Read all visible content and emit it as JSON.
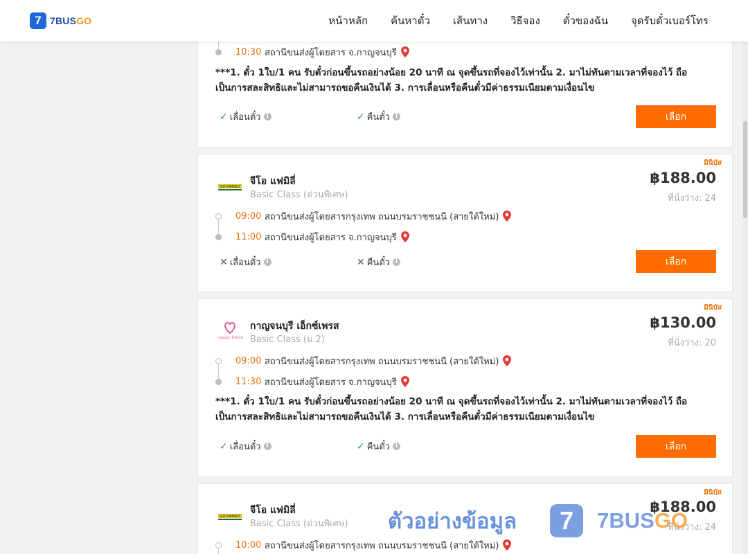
{
  "header": {
    "logo_mark": "7",
    "logo_text_main": "7BUS",
    "logo_text_go": "GO",
    "nav": [
      "หน้าหลัก",
      "ค้นหาตั๋ว",
      "เส้นทาง",
      "วิธีจอง",
      "ตั๋วของฉัน",
      "จุดรับตั๋วเบอร์โทร"
    ]
  },
  "common": {
    "select_label": "เลือก",
    "reschedule_label": "เลื่อนตั๋ว",
    "refund_label": "คืนตั๋ว",
    "minibus_tag": "มินิบัส",
    "note_text": "***1. ตั๋ว 1ใบ/1 คน รับตั๋วก่อนขึ้นรถอย่างน้อย 20 นาที ณ จุดขึ้นรถที่จองไว้เท่านั้น 2. มาไม่ทันตามเวลาที่จองไว้ ถือเป็นการสละสิทธิและไม่สามารถขอคืนเงินได้ 3. การเลื่อนหรือคืนตั๋วมีค่าธรรมเนียมตามเงื่อนไข"
  },
  "cards": [
    {
      "arrive_time": "10:30",
      "arrive_place": "สถานีขนส่งผู้โดยสาร จ.กาญจนบุรี",
      "reschedule_ok": true,
      "refund_ok": true
    },
    {
      "tag": "มินิบัส",
      "operator_logo": "GO FAMILY",
      "operator": "จีโอ แฟมิลี่",
      "class": "Basic Class (ด่วนพิเศษ)",
      "price": "฿188.00",
      "seats": "ที่นั่งว่าง: 24",
      "depart_time": "09:00",
      "depart_place": "สถานีขนส่งผู้โดยสารกรุงเทพ ถนนบรมราชชนนี (สายใต้ใหม่)",
      "arrive_time": "11:00",
      "arrive_place": "สถานีขนส่งผู้โดยสาร จ.กาญจนบุรี",
      "reschedule_ok": false,
      "refund_ok": false
    },
    {
      "tag": "มินิบัส",
      "operator_logo": "กาญจนบุรี เอ็กซ์เพรส",
      "operator": "กาญจนบุรี เอ็กซ์เพรส",
      "class": "Basic Class (ม.2)",
      "price": "฿130.00",
      "seats": "ที่นั่งว่าง: 20",
      "depart_time": "09:00",
      "depart_place": "สถานีขนส่งผู้โดยสารกรุงเทพ ถนนบรมราชชนนี (สายใต้ใหม่)",
      "arrive_time": "11:30",
      "arrive_place": "สถานีขนส่งผู้โดยสาร จ.กาญจนบุรี",
      "reschedule_ok": true,
      "refund_ok": true
    },
    {
      "tag": "มินิบัส",
      "operator_logo": "GO FAMILY",
      "operator": "จีโอ แฟมิลี่",
      "class": "Basic Class (ด่วนพิเศษ)",
      "price": "฿188.00",
      "seats": "ที่นั่งว่าง: 24",
      "depart_time": "10:00",
      "depart_place": "สถานีขนส่งผู้โดยสารกรุงเทพ ถนนบรมราชชนนี (สายใต้ใหม่)"
    }
  ],
  "watermark": {
    "text": "ตัวอย่างข้อมูล",
    "brand_main": "7BUS",
    "brand_go": "GO",
    "badge": "7"
  },
  "colors": {
    "accent": "#ff6d00",
    "time": "#e8730e",
    "pin": "#e53935",
    "ok": "#2ea44f",
    "logo_blue": "#1f66d8"
  }
}
